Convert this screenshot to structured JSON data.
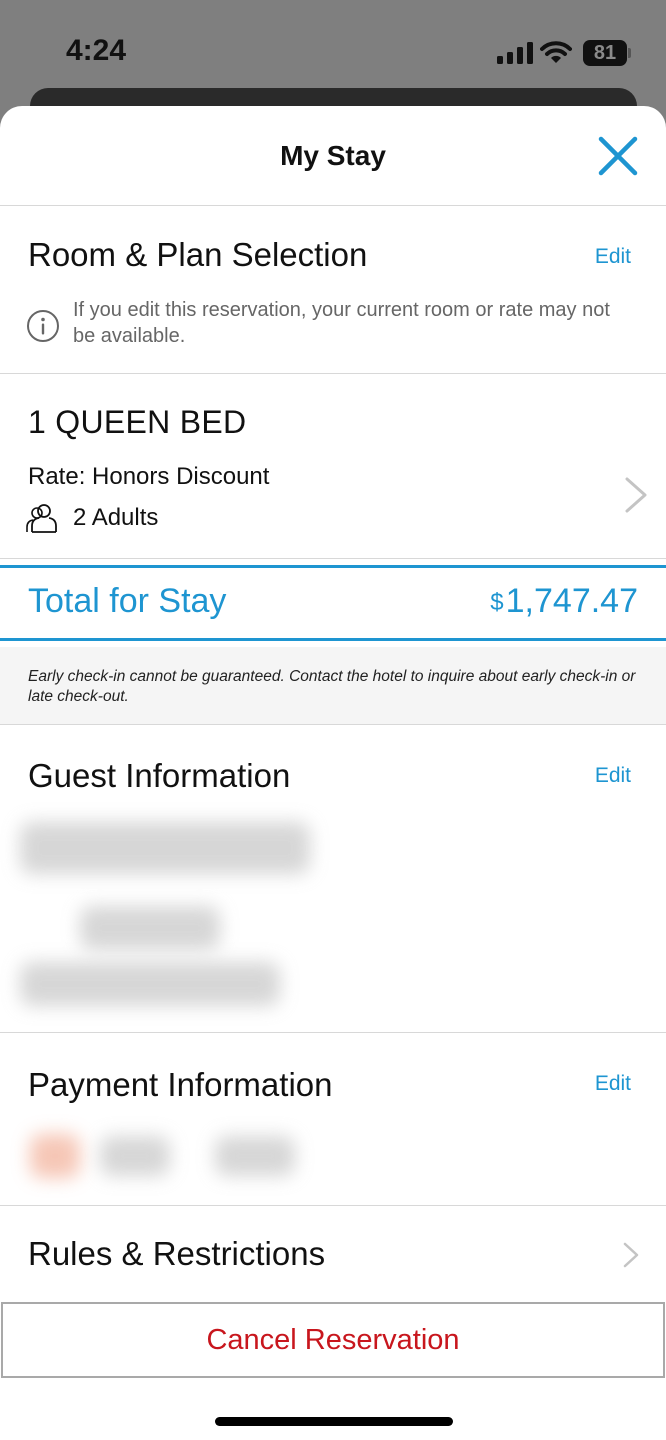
{
  "status_bar": {
    "time": "4:24",
    "battery": "81"
  },
  "sheet": {
    "title": "My Stay",
    "close_icon": "close-x-icon"
  },
  "room_plan": {
    "title": "Room & Plan Selection",
    "edit": "Edit",
    "info": "If you edit this reservation, your current room or rate may not be available."
  },
  "room": {
    "name": "1 QUEEN BED",
    "rate": "Rate: Honors Discount",
    "guests": "2 Adults"
  },
  "total": {
    "label": "Total for Stay",
    "currency": "$",
    "amount": "1,747.47"
  },
  "notice": "Early check-in cannot be guaranteed. Contact the hotel to inquire about early check-in or late check-out.",
  "guest_info": {
    "title": "Guest Information",
    "edit": "Edit"
  },
  "payment_info": {
    "title": "Payment Information",
    "edit": "Edit"
  },
  "rules": {
    "title": "Rules & Restrictions"
  },
  "cancel": {
    "label": "Cancel Reservation"
  },
  "colors": {
    "accent": "#1e95d1",
    "danger": "#c8161d"
  }
}
